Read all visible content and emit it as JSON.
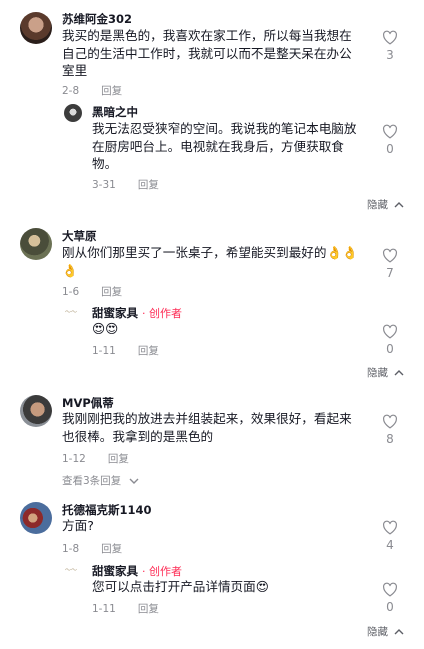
{
  "comments": [
    {
      "user": "苏维阿金302",
      "text": "我买的是黑色的，我喜欢在家工作，所以每当我想在自己的生活中工作时，我就可以而不是整天呆在办公室里",
      "date": "2-8",
      "reply_label": "回复",
      "likes": "3",
      "replies": [
        {
          "user": "黑暗之中",
          "text": "我无法忍受狭窄的空间。我说我的笔记本电脑放在厨房吧台上。电视就在我身后，方便获取食物。",
          "date": "3-31",
          "reply_label": "回复",
          "likes": "0"
        }
      ],
      "hide_label": "隐藏"
    },
    {
      "user": "大草原",
      "text": "刚从你们那里买了一张桌子，希望能买到最好的👌👌👌",
      "date": "1-6",
      "reply_label": "回复",
      "likes": "7",
      "replies": [
        {
          "user": "甜蜜家具",
          "author_tag": "· 创作者",
          "text": "😍😍",
          "date": "1-11",
          "reply_label": "回复",
          "likes": "0"
        }
      ],
      "hide_label": "隐藏"
    },
    {
      "user": "MVP佩蒂",
      "text": "我刚刚把我的放进去并组装起来，效果很好，看起来也很棒。我拿到的是黑色的",
      "date": "1-12",
      "reply_label": "回复",
      "likes": "8",
      "view_replies": "查看3条回复"
    },
    {
      "user": "托德福克斯1140",
      "text": "方面?",
      "date": "1-8",
      "reply_label": "回复",
      "likes": "4",
      "replies": [
        {
          "user": "甜蜜家具",
          "author_tag": "· 创作者",
          "text": "您可以点击打开产品详情页面😍",
          "date": "1-11",
          "reply_label": "回复",
          "likes": "0"
        }
      ],
      "hide_label": "隐藏"
    }
  ],
  "icons": {
    "like": "heart-outline-icon",
    "collapse": "chevron-up-icon",
    "expand": "chevron-down-icon"
  },
  "colors": {
    "text": "#161823",
    "muted": "#8a8b91",
    "author": "#fe2c55"
  }
}
